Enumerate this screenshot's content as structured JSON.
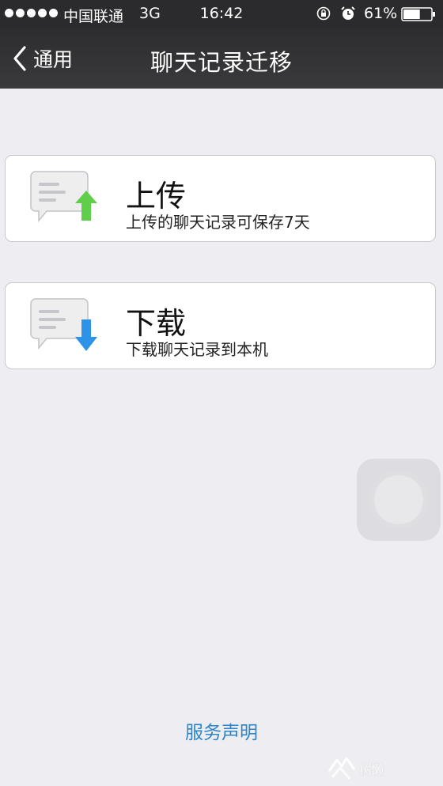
{
  "status_bar": {
    "carrier": "中国联通",
    "network": "3G",
    "time": "16:42",
    "battery": "61%",
    "battery_level": 0.61
  },
  "nav": {
    "back_label": "通用",
    "title": "聊天记录迁移"
  },
  "options": [
    {
      "title": "上传",
      "description": "上传的聊天记录可保存7天",
      "icon": "chat-upload-icon",
      "arrow_color": "#5fcf4b"
    },
    {
      "title": "下载",
      "description": "下载聊天记录到本机",
      "icon": "chat-download-icon",
      "arrow_color": "#2c93e8"
    }
  ],
  "footer": {
    "service_link": "服务声明"
  },
  "watermark": {
    "text": "树懒"
  },
  "colors": {
    "background": "#eeedf2",
    "nav_bar": "#2d2d2f",
    "link": "#2d84c8"
  }
}
